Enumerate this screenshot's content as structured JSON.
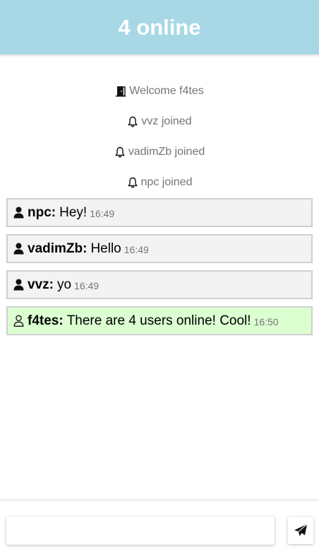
{
  "header": {
    "title": "4 online",
    "background": "#a8d8e6"
  },
  "notices": [
    {
      "icon": "door-icon",
      "text": "Welcome f4tes"
    },
    {
      "icon": "bell-icon",
      "text": "vvz joined"
    },
    {
      "icon": "bell-icon",
      "text": "vadimZb joined"
    },
    {
      "icon": "bell-icon",
      "text": "npc joined"
    }
  ],
  "messages": [
    {
      "icon": "user-icon",
      "author": "npc:",
      "text": "Hey!",
      "time": "16:49",
      "own": false
    },
    {
      "icon": "user-icon",
      "author": "vadimZb:",
      "text": "Hello",
      "time": "16:49",
      "own": false
    },
    {
      "icon": "user-icon",
      "author": "vvz:",
      "text": "yo",
      "time": "16:49",
      "own": false
    },
    {
      "icon": "user-outline-icon",
      "author": "f4tes:",
      "text": "There are 4 users online! Cool!",
      "time": "16:50",
      "own": true
    }
  ],
  "composer": {
    "value": "",
    "placeholder": "",
    "send_icon": "send-icon"
  },
  "colors": {
    "own_message_bg": "#dcffd2",
    "message_bg": "#f3f3f3",
    "muted_text": "#757575"
  }
}
